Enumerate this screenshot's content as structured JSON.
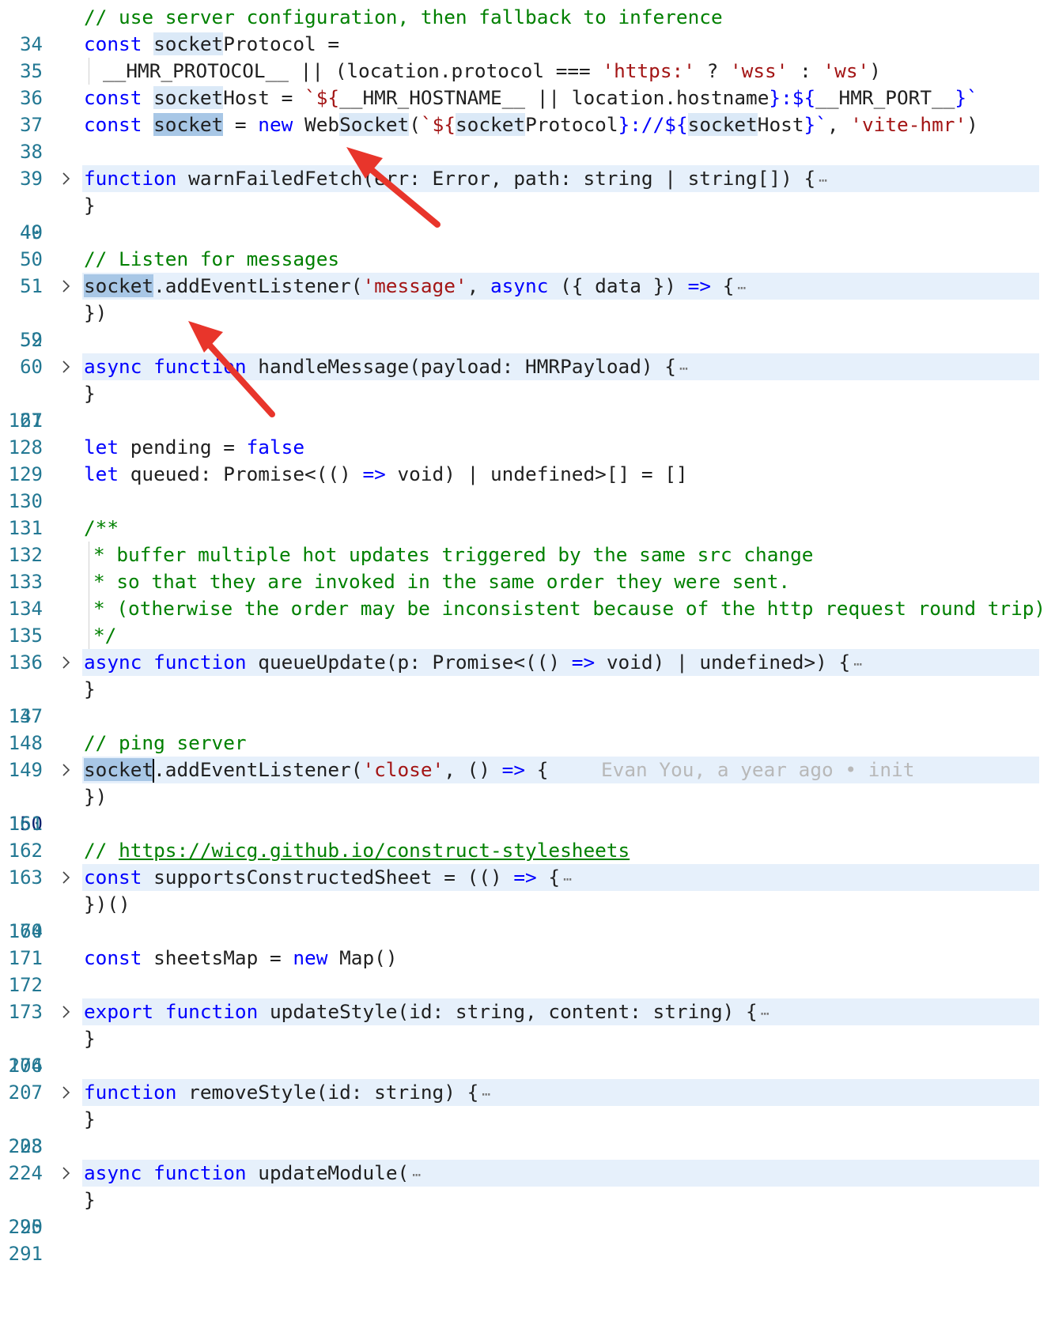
{
  "editor": {
    "blame": "Evan You, a year ago • init",
    "lines": [
      {
        "n": "34",
        "y": 5
      },
      {
        "n": "35"
      },
      {
        "n": "36"
      },
      {
        "n": "37"
      },
      {
        "n": "38"
      },
      {
        "n": "39"
      },
      {
        "n": "40"
      },
      {
        "n": "49"
      },
      {
        "n": "50"
      },
      {
        "n": "51"
      },
      {
        "n": "52"
      },
      {
        "n": "59"
      },
      {
        "n": "60"
      },
      {
        "n": "61"
      },
      {
        "n": "127"
      },
      {
        "n": "128"
      },
      {
        "n": "129"
      },
      {
        "n": "130"
      },
      {
        "n": "131"
      },
      {
        "n": "132"
      },
      {
        "n": "133"
      },
      {
        "n": "134"
      },
      {
        "n": "135"
      },
      {
        "n": "136"
      },
      {
        "n": "137"
      },
      {
        "n": "147"
      },
      {
        "n": "148"
      },
      {
        "n": "149"
      },
      {
        "n": "150"
      },
      {
        "n": "161"
      },
      {
        "n": "162"
      },
      {
        "n": "163"
      },
      {
        "n": "164"
      },
      {
        "n": "170"
      },
      {
        "n": "171"
      },
      {
        "n": "172"
      },
      {
        "n": "173"
      },
      {
        "n": "174"
      },
      {
        "n": "206"
      },
      {
        "n": "207"
      },
      {
        "n": "208"
      },
      {
        "n": "223"
      },
      {
        "n": "224"
      },
      {
        "n": "225"
      },
      {
        "n": "290"
      },
      {
        "n": "291"
      }
    ]
  },
  "code": {
    "l34": "// use server configuration, then fallback to inference",
    "l35_kw": "const",
    "l35_hl": "socket",
    "l35_rest": "Protocol =",
    "l36_a": "__HMR_PROTOCOL__ || (location.protocol === ",
    "l36_s1": "'https:'",
    "l36_b": " ? ",
    "l36_s2": "'wss'",
    "l36_c": " : ",
    "l36_s3": "'ws'",
    "l36_d": ")",
    "l37_kw": "const",
    "l37_hl": "socket",
    "l37_a": "Host = ",
    "l37_t1": "`${",
    "l37_b": "__HMR_HOSTNAME__ || location.hostname",
    "l37_t2": "}:${",
    "l37_c": "__HMR_PORT__",
    "l37_t3": "}`",
    "l38_kw": "const",
    "l38_hl": "socket",
    "l38_a": " = ",
    "l38_new": "new",
    "l38_b": " Web",
    "l38_hl2": "Socket",
    "l38_c": "(",
    "l38_t1": "`${",
    "l38_hl3": "socket",
    "l38_d": "Protocol",
    "l38_t2": "}://${",
    "l38_hl4": "socket",
    "l38_e": "Host",
    "l38_t3": "}`",
    "l38_f": ", ",
    "l38_s": "'vite-hmr'",
    "l38_g": ")",
    "l40_kw": "function",
    "l40_rest": " warnFailedFetch(err: Error, path: string | string[]) {",
    "l49": "}",
    "l51": "// Listen for messages",
    "l52_hl": "socket",
    "l52_a": ".addEventListener(",
    "l52_s": "'message'",
    "l52_b": ", ",
    "l52_kw": "async",
    "l52_c": " ({ data }) ",
    "l52_arrow": "=>",
    "l52_d": " {",
    "l59": "})",
    "l61_kw1": "async",
    "l61_kw2": "function",
    "l61_rest": " handleMessage(payload: HMRPayload) {",
    "l127": "}",
    "l129_kw": "let",
    "l129_a": " pending = ",
    "l129_kw2": "false",
    "l130_kw": "let",
    "l130_a": " queued: Promise<(() ",
    "l130_arrow": "=>",
    "l130_b": " void) | undefined>[] = []",
    "l132": "/**",
    "l133": "* buffer multiple hot updates triggered by the same src change",
    "l134": "* so that they are invoked in the same order they were sent.",
    "l135": "* (otherwise the order may be inconsistent because of the http request round trip)",
    "l136": "*/",
    "l137_kw1": "async",
    "l137_kw2": "function",
    "l137_a": " queueUpdate(p: Promise<(() ",
    "l137_arrow": "=>",
    "l137_b": " void) | undefined>) {",
    "l147": "}",
    "l149": "// ping server",
    "l150_hl": "socket",
    "l150_a": ".addEventListener(",
    "l150_s": "'close'",
    "l150_b": ", () ",
    "l150_arrow": "=>",
    "l150_c": " {",
    "l161": "})",
    "l163_a": "// ",
    "l163_link": "https://wicg.github.io/construct-stylesheets",
    "l164_kw": "const",
    "l164_a": " supportsConstructedSheet = (() ",
    "l164_arrow": "=>",
    "l164_b": " {",
    "l170": "})()",
    "l172_kw": "const",
    "l172_a": " sheetsMap = ",
    "l172_new": "new",
    "l172_b": " Map()",
    "l174_kw1": "export",
    "l174_kw2": "function",
    "l174_a": " updateStyle(id: string, content: string) {",
    "l206": "}",
    "l208_kw": "function",
    "l208_a": " removeStyle(id: string) {",
    "l223": "}",
    "l225_kw1": "async",
    "l225_kw2": "function",
    "l225_a": " updateModule(",
    "l290": "}",
    "ellipsis": "⋯"
  },
  "annotations": {
    "arrow_color": "#e8352b"
  }
}
